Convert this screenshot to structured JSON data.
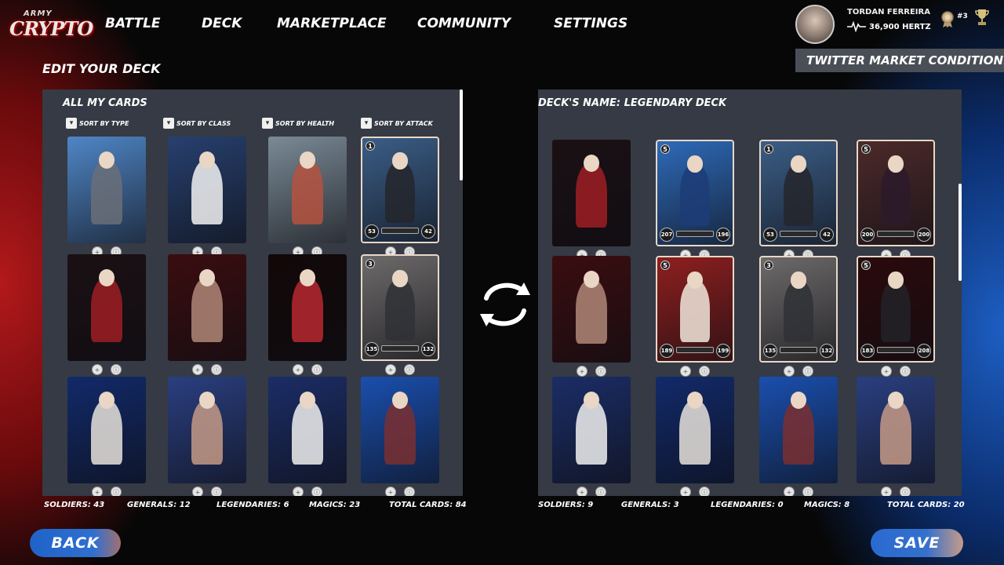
{
  "logo": {
    "line1": "ARMY",
    "line2": "CRYPTO"
  },
  "nav": [
    {
      "label": "BATTLE",
      "id": "battle"
    },
    {
      "label": "DECK",
      "id": "deck"
    },
    {
      "label": "MARKETPLACE",
      "id": "marketplace"
    },
    {
      "label": "COMMUNITY",
      "id": "community"
    },
    {
      "label": "SETTINGS",
      "id": "settings"
    }
  ],
  "profile": {
    "name": "TORDAN FERREIRA",
    "hertz": "36,900 HERTZ",
    "rank": "#3"
  },
  "twitter_banner": "TWITTER MARKET CONDITION...",
  "edit_title": "EDIT YOUR DECK",
  "left_panel": {
    "title": "ALL MY CARDS",
    "sorts": [
      "SORT BY TYPE",
      "SORT BY CLASS",
      "SORT BY HEALTH",
      "SORT BY ATTACK"
    ],
    "counts": [
      {
        "label": "SOLDIERS: 43"
      },
      {
        "label": "GENERALS: 12"
      },
      {
        "label": "LEGENDARIES: 6"
      },
      {
        "label": "MAGICS: 23"
      },
      {
        "label": "TOTAL CARDS: 84"
      }
    ],
    "cards": [
      {
        "bg": "#4f86c6",
        "fig": "#6b6f78",
        "framed": false
      },
      {
        "bg": "#27406e",
        "fig": "#f2f2f2",
        "framed": false
      },
      {
        "bg": "#7a8a96",
        "fig": "#b5523f",
        "framed": false
      },
      {
        "bg": "#3b5d86",
        "fig": "#25262c",
        "framed": true,
        "cost": "1",
        "atk": "53",
        "hp": "42"
      },
      {
        "bg": "#1b1014",
        "fig": "#9e1d25",
        "framed": false
      },
      {
        "bg": "#3a0d10",
        "fig": "#b08878",
        "framed": false
      },
      {
        "bg": "#120808",
        "fig": "#b82830",
        "framed": false
      },
      {
        "bg": "#6d6a6a",
        "fig": "#2f3136",
        "framed": true,
        "cost": "3",
        "atk": "135",
        "hp": "132"
      },
      {
        "bg": "#122a6a",
        "fig": "#e8e2da",
        "framed": false
      },
      {
        "bg": "#2a3f80",
        "fig": "#c59a86",
        "framed": false
      },
      {
        "bg": "#1b2d66",
        "fig": "#f0f0f0",
        "framed": false
      },
      {
        "bg": "#1a4fae",
        "fig": "#7a2f30",
        "framed": false
      }
    ]
  },
  "right_panel": {
    "title": "DECK'S NAME: LEGENDARY DECK",
    "counts": [
      {
        "label": "SOLDIERS: 9"
      },
      {
        "label": "GENERALS: 3"
      },
      {
        "label": "LEGENDARIES: 0"
      },
      {
        "label": "MAGICS: 8"
      },
      {
        "label": "TOTAL CARDS: 20"
      }
    ],
    "cards": [
      {
        "bg": "#1b1014",
        "fig": "#9e1d25",
        "framed": false
      },
      {
        "bg": "#2e6ab8",
        "fig": "#1d3c78",
        "framed": true,
        "cost": "5",
        "atk": "207",
        "hp": "196"
      },
      {
        "bg": "#3b5d86",
        "fig": "#25262c",
        "framed": true,
        "cost": "1",
        "atk": "53",
        "hp": "42"
      },
      {
        "bg": "#4c2a2a",
        "fig": "#2b1a2a",
        "framed": true,
        "cost": "5",
        "atk": "200",
        "hp": "200"
      },
      {
        "bg": "#3a0d10",
        "fig": "#b08878",
        "framed": false
      },
      {
        "bg": "#8e1f1f",
        "fig": "#f1e7dc",
        "framed": true,
        "cost": "5",
        "atk": "189",
        "hp": "199"
      },
      {
        "bg": "#6d6a6a",
        "fig": "#2f3136",
        "framed": true,
        "cost": "3",
        "atk": "135",
        "hp": "132"
      },
      {
        "bg": "#2b0a0c",
        "fig": "#222228",
        "framed": true,
        "cost": "5",
        "atk": "183",
        "hp": "208"
      },
      {
        "bg": "#1b2d66",
        "fig": "#f0f0f0",
        "framed": false
      },
      {
        "bg": "#122a6a",
        "fig": "#e8e2da",
        "framed": false
      },
      {
        "bg": "#1a4fae",
        "fig": "#7a2f30",
        "framed": false
      },
      {
        "bg": "#2a3f80",
        "fig": "#c59a86",
        "framed": false
      }
    ]
  },
  "buttons": {
    "back": "BACK",
    "save": "SAVE"
  },
  "colors": {
    "panel": "#353a44",
    "banner": "#4a4f57",
    "button_blue": "#2a6ad1"
  }
}
